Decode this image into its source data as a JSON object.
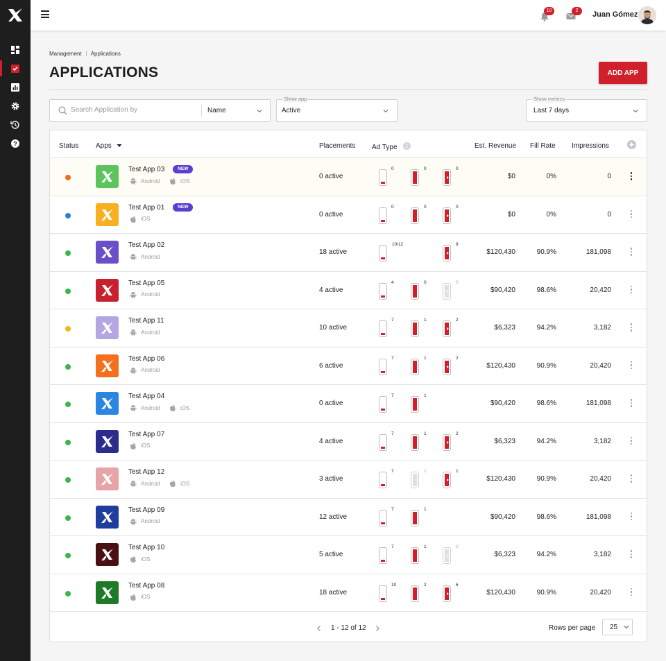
{
  "topbar": {
    "notifications_count": "10",
    "messages_count": "2",
    "user_name": "Juan Gómez"
  },
  "sidebar": {
    "items": [
      "dashboard-icon",
      "apps-icon",
      "reports-icon",
      "settings-icon",
      "history-icon",
      "help-icon"
    ],
    "active_index": 1
  },
  "breadcrumb": [
    "Management",
    "Applications"
  ],
  "page_title": "APPLICATIONS",
  "add_app_label": "ADD APP",
  "filters": {
    "search_placeholder": "Search Application by",
    "search_by": "Name",
    "show_app_label": "Show app",
    "show_app_value": "Active",
    "show_metrics_label": "Show metrics",
    "show_metrics_value": "Last 7 days"
  },
  "columns": {
    "status": "Status",
    "apps": "Apps",
    "placements": "Placements",
    "ad_type": "Ad Type",
    "revenue": "Est. Revenue",
    "fill_rate": "Fill Rate",
    "impressions": "Impressions"
  },
  "colors": {
    "accent": "#d0202c",
    "status_orange": "#f06a21",
    "status_blue": "#2b7ee0",
    "status_green": "#3cb64a",
    "status_yellow": "#f4b520",
    "new_badge": "#5b3fd0"
  },
  "rows": [
    {
      "name": "Test App 03",
      "new": "NEW",
      "status_color": "#f06a21",
      "icon_color": "#5dc45d",
      "platforms": [
        "Android",
        "iOS"
      ],
      "placements": "0 active",
      "banner": "0",
      "interstitial": "0",
      "video": "0",
      "inter_on": true,
      "video_on": true,
      "revenue": "$0",
      "fill_rate": "0%",
      "impressions": "0"
    },
    {
      "name": "Test App 01",
      "new": "NEW",
      "status_color": "#2b7ee0",
      "icon_color": "#f8b020",
      "platforms": [
        "iOS"
      ],
      "placements": "0 active",
      "banner": "0",
      "interstitial": "0",
      "video": "0",
      "inter_on": true,
      "video_on": true,
      "revenue": "$0",
      "fill_rate": "0%",
      "impressions": "0"
    },
    {
      "name": "Test App 02",
      "status_color": "#3cb64a",
      "icon_color": "#6a4fc8",
      "platforms": [
        "Android"
      ],
      "placements": "18 active",
      "banner": "10/12",
      "interstitial": "",
      "video": "8",
      "inter_on": null,
      "video_on": true,
      "revenue": "$120,430",
      "fill_rate": "90.9%",
      "impressions": "181,098"
    },
    {
      "name": "Test App 05",
      "status_color": "#3cb64a",
      "icon_color": "#c8202c",
      "platforms": [
        "Android"
      ],
      "placements": "4 active",
      "banner": "4",
      "interstitial": "0",
      "video": "0",
      "inter_on": true,
      "video_on": false,
      "revenue": "$90,420",
      "fill_rate": "98.6%",
      "impressions": "20,420"
    },
    {
      "name": "Test App 11",
      "status_color": "#f4b520",
      "icon_color": "#b3a6e3",
      "platforms": [
        "Android"
      ],
      "placements": "10 active",
      "banner": "7",
      "interstitial": "1",
      "video": "2",
      "inter_on": true,
      "video_on": true,
      "revenue": "$6,323",
      "fill_rate": "94.2%",
      "impressions": "3,182"
    },
    {
      "name": "Test App 06",
      "status_color": "#3cb64a",
      "icon_color": "#f5701e",
      "platforms": [
        "Android"
      ],
      "placements": "6 active",
      "banner": "7",
      "interstitial": "1",
      "video": "2",
      "inter_on": true,
      "video_on": true,
      "revenue": "$120,430",
      "fill_rate": "90.9%",
      "impressions": "20,420"
    },
    {
      "name": "Test App 04",
      "status_color": "#3cb64a",
      "icon_color": "#2b86e2",
      "platforms": [
        "Android",
        "iOS"
      ],
      "placements": "0 active",
      "banner": "7",
      "interstitial": "1",
      "video": "",
      "inter_on": true,
      "video_on": null,
      "revenue": "$90,420",
      "fill_rate": "98.6%",
      "impressions": "181,098"
    },
    {
      "name": "Test App 07",
      "status_color": "#3cb64a",
      "icon_color": "#2c2c8c",
      "platforms": [
        "iOS"
      ],
      "placements": "4 active",
      "banner": "7",
      "interstitial": "1",
      "video": "2",
      "inter_on": true,
      "video_on": true,
      "revenue": "$6,323",
      "fill_rate": "94.2%",
      "impressions": "3,182"
    },
    {
      "name": "Test App 12",
      "status_color": "#3cb64a",
      "icon_color": "#e6a4a8",
      "platforms": [
        "Android",
        "iOS"
      ],
      "placements": "3 active",
      "banner": "7",
      "interstitial": "1",
      "video": "1",
      "inter_on": false,
      "video_on": true,
      "revenue": "$120,430",
      "fill_rate": "90.9%",
      "impressions": "20,420"
    },
    {
      "name": "Test App 09",
      "status_color": "#3cb64a",
      "icon_color": "#1f3d9c",
      "platforms": [
        "Android"
      ],
      "placements": "12 active",
      "banner": "7",
      "interstitial": "1",
      "video": "",
      "inter_on": true,
      "video_on": null,
      "revenue": "$90,420",
      "fill_rate": "98.6%",
      "impressions": "181,098"
    },
    {
      "name": "Test App 10",
      "status_color": "#3cb64a",
      "icon_color": "#4a0f14",
      "platforms": [
        "iOS"
      ],
      "placements": "5 active",
      "banner": "7",
      "interstitial": "1",
      "video": "2",
      "inter_on": true,
      "video_on": false,
      "revenue": "$6,323",
      "fill_rate": "94.2%",
      "impressions": "3,182"
    },
    {
      "name": "Test App 08",
      "status_color": "#3cb64a",
      "icon_color": "#1e7a26",
      "platforms": [
        "iOS"
      ],
      "placements": "18 active",
      "banner": "10",
      "interstitial": "2",
      "video": "6",
      "inter_on": true,
      "video_on": true,
      "revenue": "$120,430",
      "fill_rate": "90.9%",
      "impressions": "20,420"
    }
  ],
  "pagination": {
    "range": "1 - 12 of 12",
    "rows_per_page_label": "Rows per page",
    "rows_per_page_value": "25"
  }
}
